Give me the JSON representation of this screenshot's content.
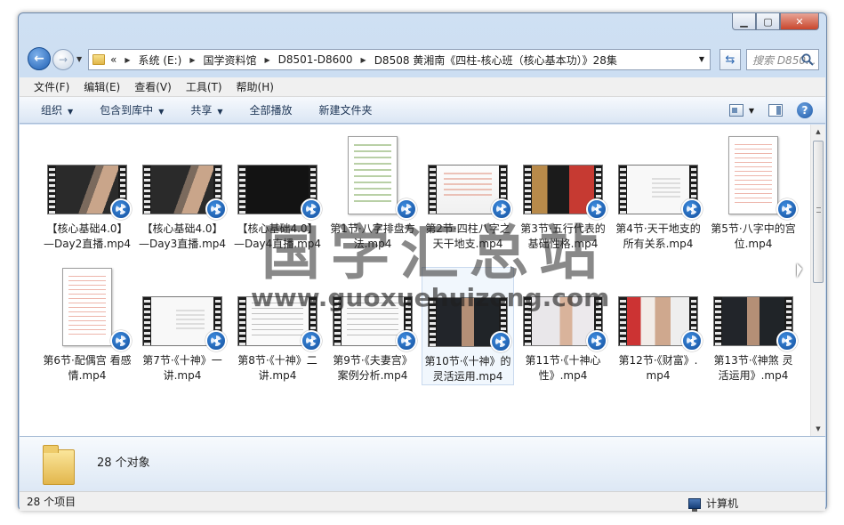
{
  "window": {
    "min_icon": "minimize-icon",
    "max_icon": "maximize-icon",
    "close_icon": "close-icon"
  },
  "address": {
    "prefix": "«",
    "crumbs": [
      "系统 (E:)",
      "国学资料馆",
      "D8501-D8600",
      "D8508 黄湘南《四柱-核心班（核心基本功）》28集"
    ],
    "search_placeholder": "搜索 D850..."
  },
  "menu": [
    "文件(F)",
    "编辑(E)",
    "查看(V)",
    "工具(T)",
    "帮助(H)"
  ],
  "commands": {
    "organize": "组织",
    "include_library": "包含到库中",
    "share": "共享",
    "play_all": "全部播放",
    "new_folder": "新建文件夹"
  },
  "files": [
    {
      "name": "【核心基础4.0】—Day2直播.mp4",
      "thumb": "person"
    },
    {
      "name": "【核心基础4.0】—Day3直播.mp4",
      "thumb": "person"
    },
    {
      "name": "【核心基础4.0】—Day4直播.mp4",
      "thumb": "dark"
    },
    {
      "name": "第1节·八字排盘方法.mp4",
      "thumb": "phone-doc"
    },
    {
      "name": "第2节·四柱八字之天干地支.mp4",
      "thumb": "ppt"
    },
    {
      "name": "第3节·五行代表的基础性格.mp4",
      "thumb": "board"
    },
    {
      "name": "第4节·天干地支的所有关系.mp4",
      "thumb": "white"
    },
    {
      "name": "第5节·八字中的宫位.mp4",
      "thumb": "doc"
    },
    {
      "name": "第6节·配偶宫 看感情.mp4",
      "thumb": "doc"
    },
    {
      "name": "第7节·《十神》一讲.mp4",
      "thumb": "white"
    },
    {
      "name": "第8节·《十神》二讲.mp4",
      "thumb": "lines"
    },
    {
      "name": "第9节·《夫妻宫》案例分析.mp4",
      "thumb": "lines"
    },
    {
      "name": "第10节·《十神》的灵活运用.mp4",
      "thumb": "room"
    },
    {
      "name": "第11节·《十神心性》.mp4",
      "thumb": "light"
    },
    {
      "name": "第12节·《财富》.mp4",
      "thumb": "wall"
    },
    {
      "name": "第13节·《神煞 灵活运用》.mp4",
      "thumb": "room"
    }
  ],
  "details": {
    "count": "28 个对象"
  },
  "status": {
    "items": "28 个项目",
    "location": "计算机"
  },
  "watermark": {
    "cn": "国学汇总站",
    "url": "www.guoxuehuizong.com"
  }
}
